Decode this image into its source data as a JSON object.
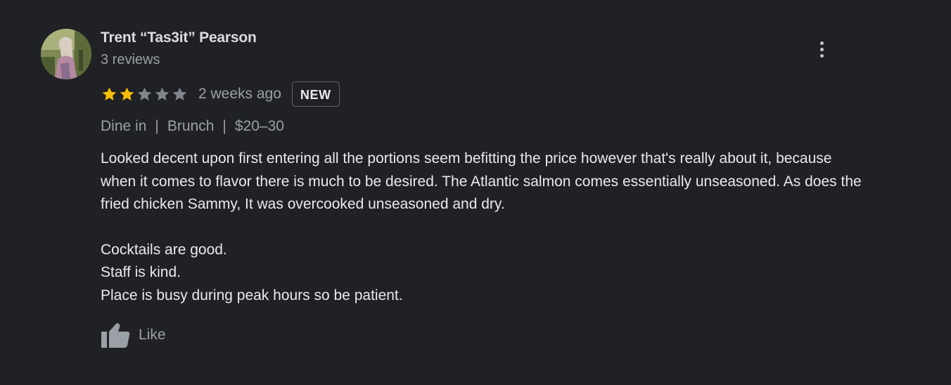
{
  "review": {
    "author": {
      "name": "Trent “Tas3it” Pearson",
      "review_count": "3 reviews",
      "avatar_icon": "user-photo-avatar"
    },
    "menu_icon": "more-vert-icon",
    "rating": {
      "value": 2,
      "max": 5,
      "filled_color": "#fbbc04",
      "empty_color": "#80868b"
    },
    "time_ago": "2 weeks ago",
    "badge": "NEW",
    "meta": {
      "service": "Dine in",
      "meal": "Brunch",
      "price": "$20–30",
      "separator": "|"
    },
    "text": {
      "paragraph_1": "Looked decent upon first entering all the portions seem befitting the price however that's really about it, because when it comes to flavor there is much to be desired. The Atlantic salmon comes essentially unseasoned. As does the fried chicken Sammy, It was overcooked unseasoned and dry.",
      "line_1": "Cocktails are good.",
      "line_2": "Staff is kind.",
      "line_3": "Place is busy during peak hours so be patient."
    },
    "like": {
      "label": "Like",
      "icon": "thumb-up-icon"
    }
  },
  "colors": {
    "background": "#202124",
    "primary_text": "#e8eaed",
    "secondary_text": "#9aa0a6"
  }
}
